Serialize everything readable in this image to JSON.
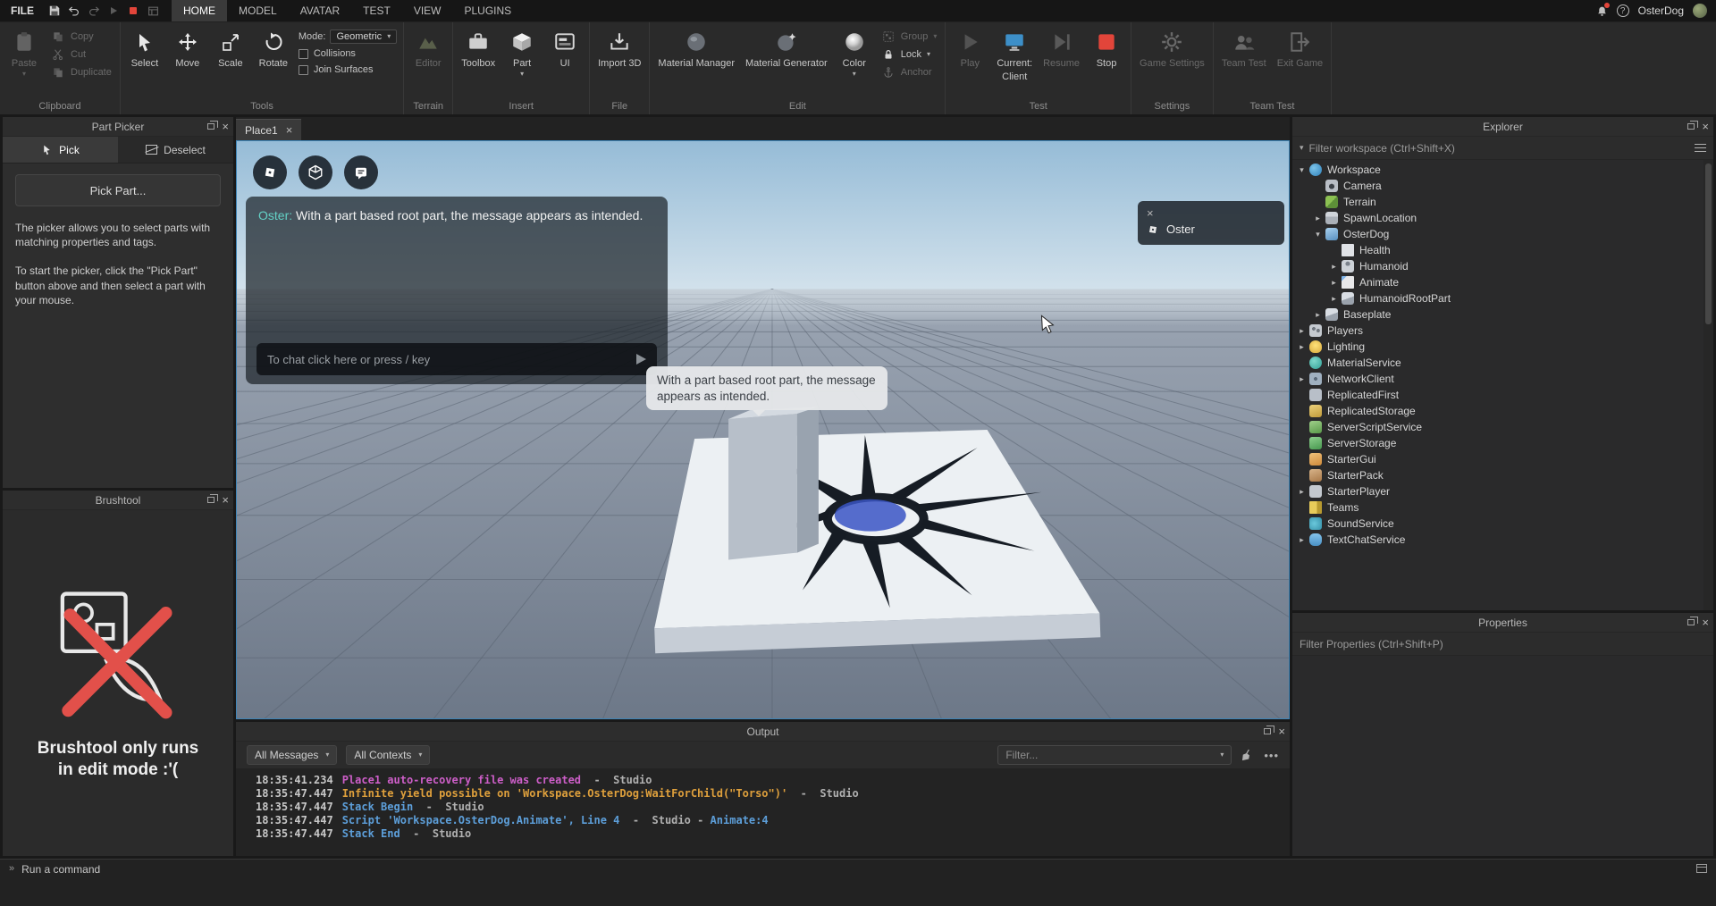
{
  "colors": {
    "accent_blue": "#3e85b8",
    "stop_red": "#e2453a",
    "warning_orange": "#dfa03c",
    "recovery_magenta": "#cd5ec8",
    "stack_blue": "#5d9fda",
    "chat_name_teal": "#63d1c6",
    "brush_x_red": "#e2504a"
  },
  "menubar": {
    "file": "FILE",
    "tabs": [
      {
        "label": "HOME"
      },
      {
        "label": "MODEL"
      },
      {
        "label": "AVATAR"
      },
      {
        "label": "TEST"
      },
      {
        "label": "VIEW"
      },
      {
        "label": "PLUGINS"
      }
    ],
    "user": "OsterDog"
  },
  "ribbon": {
    "clipboard": {
      "label": "Clipboard",
      "paste": "Paste",
      "copy": "Copy",
      "cut": "Cut",
      "duplicate": "Duplicate"
    },
    "tools": {
      "label": "Tools",
      "select": "Select",
      "move": "Move",
      "scale": "Scale",
      "rotate": "Rotate",
      "mode_label": "Mode:",
      "mode_value": "Geometric",
      "collisions": "Collisions",
      "join_surfaces": "Join Surfaces"
    },
    "terrain": {
      "label": "Terrain",
      "editor": "Editor"
    },
    "insert": {
      "label": "Insert",
      "toolbox": "Toolbox",
      "part": "Part",
      "ui": "UI"
    },
    "file": {
      "label": "File",
      "import3d": "Import 3D"
    },
    "edit": {
      "label": "Edit",
      "material_manager": "Material Manager",
      "material_generator": "Material Generator",
      "color": "Color",
      "group": "Group",
      "lock": "Lock",
      "anchor": "Anchor"
    },
    "test": {
      "label": "Test",
      "play": "Play",
      "current_line1": "Current:",
      "current_line2": "Client",
      "resume": "Resume",
      "stop": "Stop"
    },
    "settings": {
      "label": "Settings",
      "game_settings": "Game Settings"
    },
    "team_test": {
      "label": "Team Test",
      "team_test": "Team Test",
      "exit_game": "Exit Game"
    }
  },
  "part_picker": {
    "title": "Part Picker",
    "tab_pick": "Pick",
    "tab_deselect": "Deselect",
    "pick_button": "Pick Part...",
    "para1": "The picker allows you to select parts with matching properties and tags.",
    "para2": "To start the picker, click the \"Pick Part\" button above and then select a part with your mouse."
  },
  "brushtool": {
    "title": "Brushtool",
    "message": "Brushtool only runs in edit mode :'("
  },
  "viewport": {
    "tab": "Place1",
    "chat": {
      "speaker": "Oster:",
      "message": "With a part based root part, the message appears as intended.",
      "input_placeholder": "To chat click here or press / key"
    },
    "player_list": {
      "player": "Oster"
    },
    "bubble": "With a part based root part, the message appears as intended."
  },
  "output": {
    "title": "Output",
    "filter_messages": "All Messages",
    "filter_contexts": "All Contexts",
    "filter_placeholder": "Filter...",
    "logs": [
      {
        "time": "18:35:41.234",
        "msg": "Place1 auto-recovery file was created",
        "src": "Studio",
        "type": "recovery"
      },
      {
        "time": "18:35:47.447",
        "msg": "Infinite yield possible on 'Workspace.OsterDog:WaitForChild(\"Torso\")'",
        "src": "Studio",
        "type": "warning"
      },
      {
        "time": "18:35:47.447",
        "msg": "Stack Begin",
        "src": "Studio",
        "type": "stack"
      },
      {
        "time": "18:35:47.447",
        "msg": "Script 'Workspace.OsterDog.Animate', Line 4",
        "src": "Studio",
        "link": "Animate:4",
        "type": "stack"
      },
      {
        "time": "18:35:47.447",
        "msg": "Stack End",
        "src": "Studio",
        "type": "stack"
      }
    ]
  },
  "explorer": {
    "title": "Explorer",
    "filter_placeholder": "Filter workspace (Ctrl+Shift+X)",
    "tree": [
      {
        "label": "Workspace",
        "icon": "workspace",
        "arrow": "expanded",
        "depth": 0
      },
      {
        "label": "Camera",
        "icon": "camera",
        "arrow": "none",
        "depth": 1
      },
      {
        "label": "Terrain",
        "icon": "terrain",
        "arrow": "none",
        "depth": 1
      },
      {
        "label": "SpawnLocation",
        "icon": "spawnlocation",
        "arrow": "collapsed",
        "depth": 1
      },
      {
        "label": "OsterDog",
        "icon": "model",
        "arrow": "expanded",
        "depth": 1
      },
      {
        "label": "Health",
        "icon": "health",
        "arrow": "none",
        "depth": 2
      },
      {
        "label": "Humanoid",
        "icon": "humanoid",
        "arrow": "collapsed",
        "depth": 2
      },
      {
        "label": "Animate",
        "icon": "animate",
        "arrow": "collapsed",
        "depth": 2
      },
      {
        "label": "HumanoidRootPart",
        "icon": "part",
        "arrow": "collapsed",
        "depth": 2
      },
      {
        "label": "Baseplate",
        "icon": "part",
        "arrow": "collapsed",
        "depth": 1
      },
      {
        "label": "Players",
        "icon": "players",
        "arrow": "collapsed",
        "depth": 0
      },
      {
        "label": "Lighting",
        "icon": "lighting",
        "arrow": "collapsed",
        "depth": 0
      },
      {
        "label": "MaterialService",
        "icon": "material",
        "arrow": "none",
        "depth": 0
      },
      {
        "label": "NetworkClient",
        "icon": "network",
        "arrow": "collapsed",
        "depth": 0
      },
      {
        "label": "ReplicatedFirst",
        "icon": "replicatedfirst",
        "arrow": "none",
        "depth": 0
      },
      {
        "label": "ReplicatedStorage",
        "icon": "replicatedstorage",
        "arrow": "none",
        "depth": 0
      },
      {
        "label": "ServerScriptService",
        "icon": "serverscript",
        "arrow": "none",
        "depth": 0
      },
      {
        "label": "ServerStorage",
        "icon": "serverstorage",
        "arrow": "none",
        "depth": 0
      },
      {
        "label": "StarterGui",
        "icon": "startergui",
        "arrow": "none",
        "depth": 0
      },
      {
        "label": "StarterPack",
        "icon": "starterpack",
        "arrow": "none",
        "depth": 0
      },
      {
        "label": "StarterPlayer",
        "icon": "starterplayer",
        "arrow": "collapsed",
        "depth": 0
      },
      {
        "label": "Teams",
        "icon": "teams",
        "arrow": "none",
        "depth": 0
      },
      {
        "label": "SoundService",
        "icon": "sound",
        "arrow": "none",
        "depth": 0
      },
      {
        "label": "TextChatService",
        "icon": "textchat",
        "arrow": "collapsed",
        "depth": 0
      }
    ]
  },
  "properties": {
    "title": "Properties",
    "filter_placeholder": "Filter Properties (Ctrl+Shift+P)"
  },
  "statusbar": {
    "command": "Run a command"
  }
}
